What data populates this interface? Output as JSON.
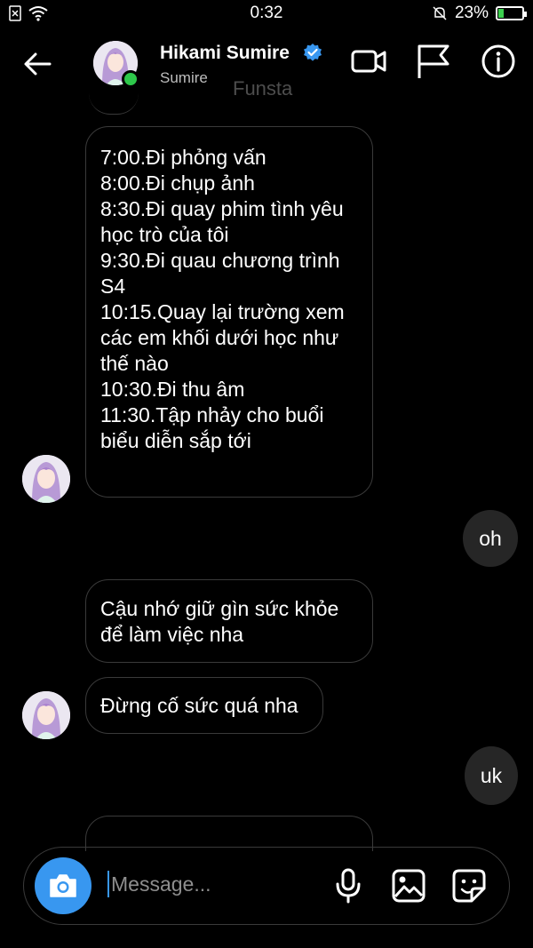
{
  "status_bar": {
    "time": "0:32",
    "battery_text": "23%",
    "battery_level": 0.23
  },
  "header": {
    "name": "Hikami Sumire",
    "username": "Sumire",
    "watermark": "Funsta",
    "icons": [
      "back-arrow-icon",
      "video-call-icon",
      "flag-icon",
      "info-icon"
    ]
  },
  "messages": {
    "schedule": [
      "7:00.Đi phỏng vấn",
      "8:00.Đi chụp ảnh",
      "8:30.Đi quay phim tình yêu",
      "học trò của tôi",
      "9:30.Đi quau chương trình",
      "S4",
      "10:15.Quay lại trường xem",
      "các em khối dưới học như",
      "thế nào",
      "10:30.Đi thu âm",
      "11:30.Tập nhảy cho buổi",
      "biểu diễn sắp tới"
    ],
    "reply_oh": "oh",
    "care": [
      "Cậu nhớ giữ gìn sức khỏe",
      "để làm việc nha"
    ],
    "dont_overwork": "Đừng cố sức quá nha",
    "reply_uk": "uk"
  },
  "composer": {
    "placeholder": "Message..."
  },
  "colors": {
    "background": "#000000",
    "accent": "#3897f0",
    "online": "#2ec84b",
    "outgoing_bubble": "#262626"
  }
}
